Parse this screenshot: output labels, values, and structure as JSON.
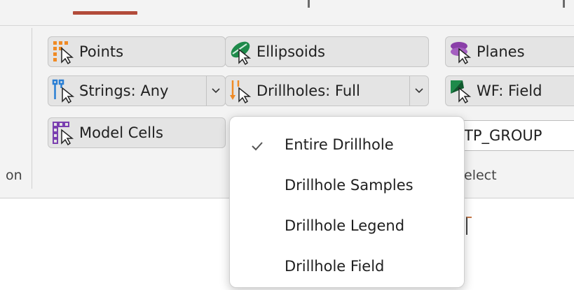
{
  "ribbon": {
    "left_group_caption": "on",
    "buttons": {
      "points": "Points",
      "ellipsoids": "Ellipsoids",
      "planes": "Planes",
      "strings": "Strings: Any",
      "drillholes": "Drillholes: Full",
      "wireframes": "WF: Field",
      "model_cells": "Model Cells"
    },
    "select_group": {
      "combo_value": "TP_GROUP",
      "caption": "elect"
    }
  },
  "dropdown": {
    "items": [
      {
        "label": "Entire Drillhole",
        "checked": true
      },
      {
        "label": "Drillhole Samples",
        "checked": false
      },
      {
        "label": "Drillhole Legend",
        "checked": false
      },
      {
        "label": "Drillhole Field",
        "checked": false
      }
    ]
  },
  "colors": {
    "accent_tab": "#b24b3a",
    "points_icon": "#f08a24",
    "strings_icon": "#2a7fd4",
    "ellipsoid_icon": "#1e8a4a",
    "planes_icon": "#8a3fa8",
    "model_cells_icon": "#7a3fb0"
  },
  "icons": [
    "points-icon",
    "ellipsoids-icon",
    "planes-icon",
    "strings-icon",
    "drillholes-icon",
    "wireframe-icon",
    "model-cells-icon",
    "chevron-down-icon",
    "checkmark-icon"
  ]
}
